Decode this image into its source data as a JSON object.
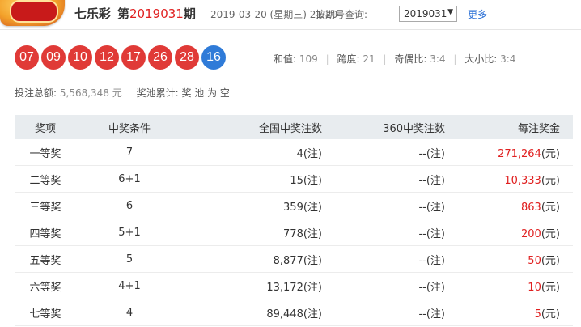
{
  "header": {
    "lottery_name": "七乐彩",
    "issue_prefix": "第",
    "issue_number": "2019031",
    "issue_suffix": "期",
    "draw_date": "2019-03-20 (星期三) 21:20",
    "query_label": "按期号查询:",
    "selected_issue": "2019031",
    "more_link": "更多"
  },
  "balls": {
    "red": [
      "07",
      "09",
      "10",
      "12",
      "17",
      "26",
      "28"
    ],
    "blue": [
      "16"
    ]
  },
  "stats": {
    "sum_label": "和值:",
    "sum_value": "109",
    "span_label": "跨度:",
    "span_value": "21",
    "odd_even_label": "奇偶比:",
    "odd_even_value": "3:4",
    "big_small_label": "大小比:",
    "big_small_value": "3:4"
  },
  "sales": {
    "total_label": "投注总额:",
    "total_value": "5,568,348 元",
    "jackpot_label": "奖池累计:",
    "jackpot_value": "奖 池 为 空"
  },
  "table": {
    "headers": [
      "奖项",
      "中奖条件",
      "全国中奖注数",
      "360中奖注数",
      "每注奖金"
    ],
    "rows": [
      [
        "一等奖",
        "7",
        "4(注)",
        "--(注)",
        "271,264",
        "(元)"
      ],
      [
        "二等奖",
        "6+1",
        "15(注)",
        "--(注)",
        "10,333",
        "(元)"
      ],
      [
        "三等奖",
        "6",
        "359(注)",
        "--(注)",
        "863",
        "(元)"
      ],
      [
        "四等奖",
        "5+1",
        "778(注)",
        "--(注)",
        "200",
        "(元)"
      ],
      [
        "五等奖",
        "5",
        "8,877(注)",
        "--(注)",
        "50",
        "(元)"
      ],
      [
        "六等奖",
        "4+1",
        "13,172(注)",
        "--(注)",
        "10",
        "(元)"
      ],
      [
        "七等奖",
        "4",
        "89,448(注)",
        "--(注)",
        "5",
        "(元)"
      ]
    ]
  },
  "colors": {
    "red_ball": "#e03a37",
    "blue_ball": "#2f7bd8",
    "accent_red": "#e02020",
    "link_blue": "#2a6fd6",
    "table_header_bg": "#e8ecef"
  }
}
